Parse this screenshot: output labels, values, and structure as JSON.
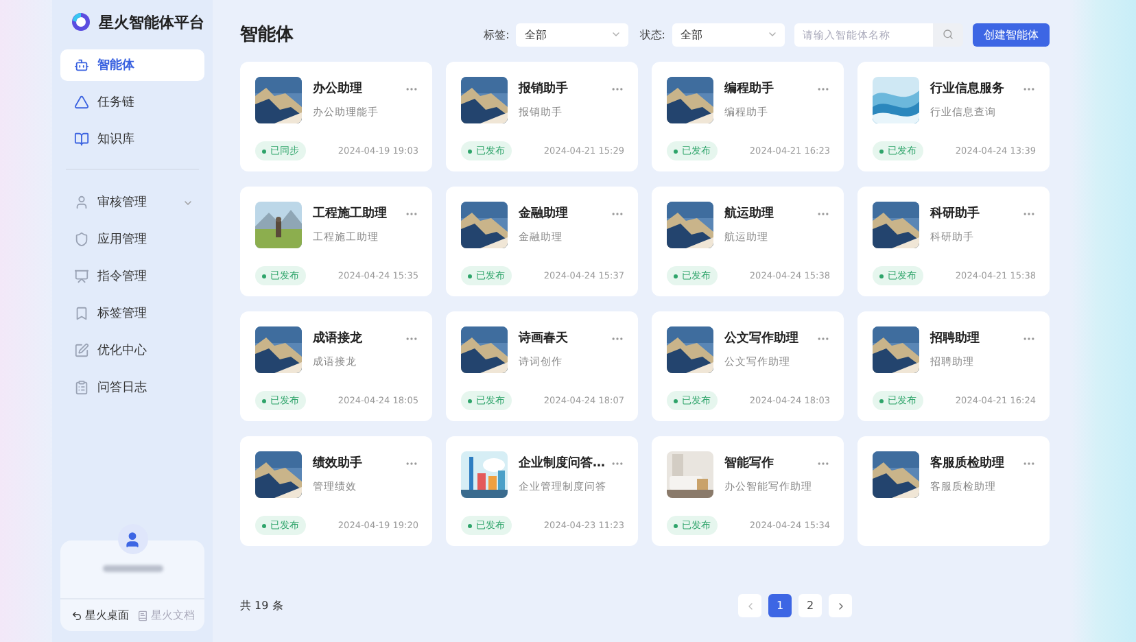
{
  "app": {
    "title": "星火智能体平台"
  },
  "sidebar": {
    "items": [
      {
        "label": "智能体",
        "selected": true
      },
      {
        "label": "任务链",
        "selected": false
      },
      {
        "label": "知识库",
        "selected": false
      }
    ],
    "admin_items": [
      {
        "label": "审核管理",
        "selected": false,
        "expanded": false
      },
      {
        "label": "应用管理",
        "selected": false
      },
      {
        "label": "指令管理",
        "selected": false
      },
      {
        "label": "标签管理",
        "selected": false
      },
      {
        "label": "优化中心",
        "selected": false
      },
      {
        "label": "问答日志",
        "selected": false
      }
    ],
    "footer_links": [
      {
        "label": "星火桌面",
        "disabled": false
      },
      {
        "label": "星火文档",
        "disabled": true
      }
    ]
  },
  "page_title": "智能体",
  "filters": [
    {
      "label": "标签:",
      "value": "全部"
    },
    {
      "label": "状态:",
      "value": "全部"
    }
  ],
  "search": {
    "placeholder": "请输入智能体名称"
  },
  "create_button": "创建智能体",
  "cards": [
    {
      "title": "办公助理",
      "subtitle": "办公助理能手",
      "status": "已同步",
      "time": "2024-04-19 19:03"
    },
    {
      "title": "报销助手",
      "subtitle": "报销助手",
      "status": "已发布",
      "time": "2024-04-21 15:29"
    },
    {
      "title": "编程助手",
      "subtitle": "编程助手",
      "status": "已发布",
      "time": "2024-04-21 16:23"
    },
    {
      "title": "行业信息服务",
      "subtitle": "行业信息查询",
      "status": "已发布",
      "time": "2024-04-24 13:39"
    },
    {
      "title": "工程施工助理",
      "subtitle": "工程施工助理",
      "status": "已发布",
      "time": "2024-04-24 15:35"
    },
    {
      "title": "金融助理",
      "subtitle": "金融助理",
      "status": "已发布",
      "time": "2024-04-24 15:37"
    },
    {
      "title": "航运助理",
      "subtitle": "航运助理",
      "status": "已发布",
      "time": "2024-04-24 15:38"
    },
    {
      "title": "科研助手",
      "subtitle": "科研助手",
      "status": "已发布",
      "time": "2024-04-21 15:38"
    },
    {
      "title": "成语接龙",
      "subtitle": "成语接龙",
      "status": "已发布",
      "time": "2024-04-24 18:05"
    },
    {
      "title": "诗画春天",
      "subtitle": "诗词创作",
      "status": "已发布",
      "time": "2024-04-24 18:07"
    },
    {
      "title": "公文写作助理",
      "subtitle": "公文写作助理",
      "status": "已发布",
      "time": "2024-04-24 18:03"
    },
    {
      "title": "招聘助理",
      "subtitle": "招聘助理",
      "status": "已发布",
      "time": "2024-04-21 16:24"
    },
    {
      "title": "绩效助手",
      "subtitle": "管理绩效",
      "status": "已发布",
      "time": "2024-04-19 19:20"
    },
    {
      "title": "企业制度问答…",
      "subtitle": "企业管理制度问答",
      "status": "已发布",
      "time": "2024-04-23 11:23"
    },
    {
      "title": "智能写作",
      "subtitle": "办公智能写作助理",
      "status": "已发布",
      "time": "2024-04-24 15:34"
    },
    {
      "title": "客服质检助理",
      "subtitle": "客服质检助理"
    }
  ],
  "total": "共 19 条",
  "pagination": [
    {
      "label": "1",
      "selected": true
    },
    {
      "label": "2",
      "selected": false
    }
  ]
}
